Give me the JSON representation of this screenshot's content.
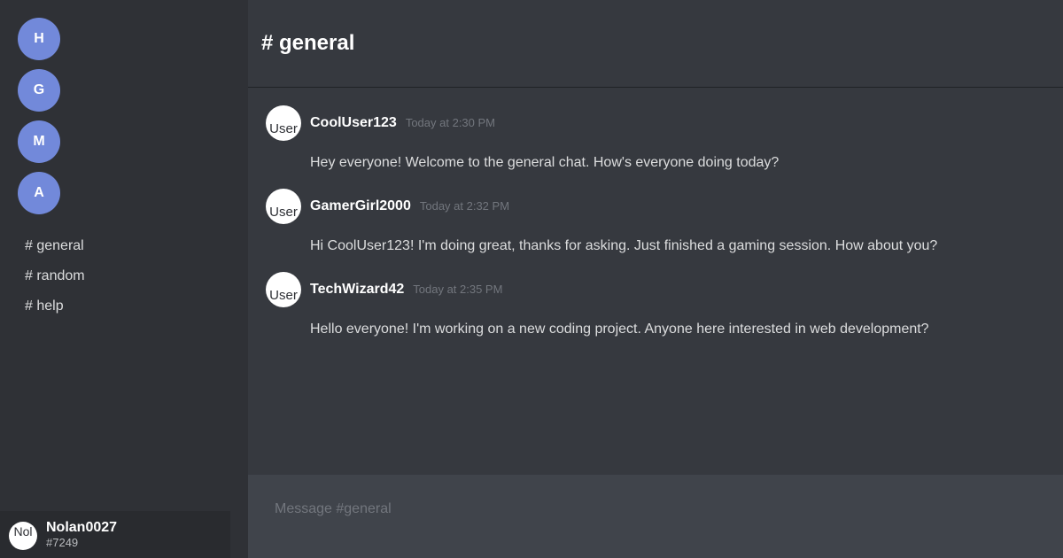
{
  "servers": [
    {
      "initial": "H"
    },
    {
      "initial": "G"
    },
    {
      "initial": "M"
    },
    {
      "initial": "A"
    }
  ],
  "channels": [
    {
      "label": "# general"
    },
    {
      "label": "# random"
    },
    {
      "label": "# help"
    }
  ],
  "header": {
    "title": "# general"
  },
  "messages": [
    {
      "author": "CoolUser123",
      "time": "Today at 2:30 PM",
      "text": "Hey everyone! Welcome to the general chat. How's everyone doing today?",
      "avatar_alt": "User"
    },
    {
      "author": "GamerGirl2000",
      "time": "Today at 2:32 PM",
      "text": "Hi CoolUser123! I'm doing great, thanks for asking. Just finished a gaming session. How about you?",
      "avatar_alt": "User"
    },
    {
      "author": "TechWizard42",
      "time": "Today at 2:35 PM",
      "text": "Hello everyone! I'm working on a new coding project. Anyone here interested in web development?",
      "avatar_alt": "User"
    }
  ],
  "composer": {
    "value": "",
    "placeholder": "Message #general"
  },
  "user": {
    "name": "Nolan0027",
    "tag": "#7249",
    "avatar_alt": "Nol"
  },
  "colors": {
    "sidebar_bg": "#2f3136",
    "main_bg": "#36393f",
    "accent": "#7289da",
    "user_panel_bg": "#292b2f",
    "composer_bg": "#40444b"
  }
}
